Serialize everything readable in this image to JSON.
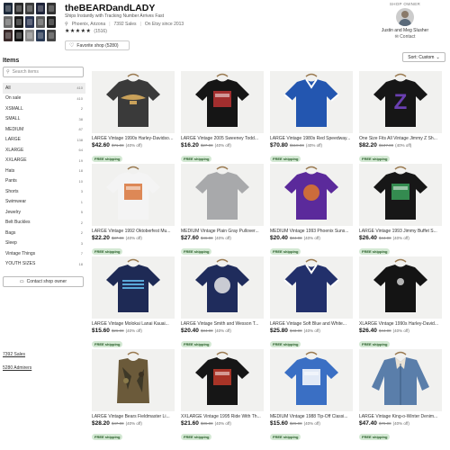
{
  "shop": {
    "name": "theBEARDandLADY",
    "tagline": "Ships Instantly with Tracking Number Arrives Fast",
    "location": "Phoenix, Arizona",
    "sales": "7392 Sales",
    "since": "On Etsy since 2013",
    "stars": "★★★★★",
    "review_count": "(1516)",
    "favorite_label": "Favorite shop (5280)",
    "heart_icon": "heart-icon",
    "mosaic_colors": [
      "#1e2a3a",
      "#2a2a2a",
      "#3d3d3d",
      "#20253a",
      "#333",
      "#6b6b6b",
      "#1a1a1a",
      "#2b3550",
      "#5a5a5a",
      "#202020",
      "#3a2a2a",
      "#151515",
      "#8a8a8a",
      "#2a3a55",
      "#444"
    ]
  },
  "owner": {
    "label": "SHOP OWNER",
    "name": "Justin and Meg Slusher",
    "contact": "Contact"
  },
  "sort": {
    "label": "Sort: Custom",
    "icon": "chevron-down-icon"
  },
  "sidebar": {
    "title": "Items",
    "search_placeholder": "Search items",
    "categories": [
      {
        "label": "All",
        "count": "410"
      },
      {
        "label": "On sale",
        "count": "410"
      },
      {
        "label": "XSMALL",
        "count": "2"
      },
      {
        "label": "SMALL",
        "count": "38"
      },
      {
        "label": "MEDIUM",
        "count": "87"
      },
      {
        "label": "LARGE",
        "count": "138"
      },
      {
        "label": "XLARGE",
        "count": "64"
      },
      {
        "label": "XXLARGE",
        "count": "19"
      },
      {
        "label": "Hats",
        "count": "18"
      },
      {
        "label": "Pants",
        "count": "10"
      },
      {
        "label": "Shorts",
        "count": "3"
      },
      {
        "label": "Swimwear",
        "count": "1"
      },
      {
        "label": "Jewelry",
        "count": "5"
      },
      {
        "label": "Belt Buckles",
        "count": "2"
      },
      {
        "label": "Bags",
        "count": "2"
      },
      {
        "label": "Sleep",
        "count": "3"
      },
      {
        "label": "Vintage Things",
        "count": "7"
      },
      {
        "label": "YOUTH SIZES",
        "count": "18"
      }
    ],
    "contact_label": "Contact shop owner",
    "sales_link": "7392 Sales",
    "admirers_link": "5280 Admirers"
  },
  "listings": [
    {
      "title": "LARGE Vintage 1990s Harley-Davidson...",
      "price": "$42.60",
      "orig": "$71.00",
      "off": "(40% off)",
      "badge": "FREE shipping",
      "shirt": "#3a3a3a",
      "accent": "#c9a15a",
      "print": "wings"
    },
    {
      "title": "LARGE Vintage 2005 Sweeney Todd...",
      "price": "$16.20",
      "orig": "$27.00",
      "off": "(40% off)",
      "badge": "FREE shipping",
      "shirt": "#151515",
      "accent": "#b33",
      "print": "box"
    },
    {
      "title": "LARGE Vintage 1980s Red Speedway...",
      "price": "$70.80",
      "orig": "$118.00",
      "off": "(40% off)",
      "badge": "FREE shipping",
      "shirt": "#2356b0",
      "accent": "#fff",
      "print": "vneck"
    },
    {
      "title": "One Size Fits All Vintage Jimmy Z Sh...",
      "price": "$82.20",
      "orig": "$137.00",
      "off": "(40% off)",
      "badge": "FREE shipping",
      "shirt": "#161616",
      "accent": "#6a3fb0",
      "print": "letter"
    },
    {
      "title": "LARGE Vintage 1992 Oktoberfest Mu...",
      "price": "$22.20",
      "orig": "$37.00",
      "off": "(40% off)",
      "badge": "FREE shipping",
      "shirt": "#f4f4f4",
      "accent": "#d8743a",
      "print": "box"
    },
    {
      "title": "MEDIUM Vintage Plain Gray Pullover...",
      "price": "$27.60",
      "orig": "$46.00",
      "off": "(40% off)",
      "badge": "FREE shipping",
      "shirt": "#a8a9ab",
      "accent": "#999",
      "print": "none"
    },
    {
      "title": "MEDIUM Vintage 1993 Phoenix Suns...",
      "price": "$20.40",
      "orig": "$34.00",
      "off": "(40% off)",
      "badge": "FREE shipping",
      "shirt": "#5b2a9b",
      "accent": "#e0782a",
      "print": "circle"
    },
    {
      "title": "LARGE Vintage 1993 Jimmy Buffet S...",
      "price": "$26.40",
      "orig": "$44.00",
      "off": "(40% off)",
      "badge": "FREE shipping",
      "shirt": "#171717",
      "accent": "#3aa05a",
      "print": "box"
    },
    {
      "title": "LARGE Vintage Molokai Lanai Kauai...",
      "price": "$15.60",
      "orig": "$26.00",
      "off": "(40% off)",
      "badge": "FREE shipping",
      "shirt": "#1e2a55",
      "accent": "#5aa8d8",
      "print": "stripes"
    },
    {
      "title": "LARGE Vintage Smith and Wesson T...",
      "price": "$20.40",
      "orig": "$34.00",
      "off": "(40% off)",
      "badge": "FREE shipping",
      "shirt": "#1f2c5c",
      "accent": "#e8e8e8",
      "print": "circle"
    },
    {
      "title": "LARGE Vintage Soft Blue and White...",
      "price": "$25.80",
      "orig": "$43.00",
      "off": "(40% off)",
      "badge": "FREE shipping",
      "shirt": "#22306b",
      "accent": "#fff",
      "print": "vneck"
    },
    {
      "title": "XLARGE Vintage 1990s Harley-David...",
      "price": "$26.40",
      "orig": "$44.00",
      "off": "(40% off)",
      "badge": "FREE shipping",
      "shirt": "#141414",
      "accent": "#ddd",
      "print": "small"
    },
    {
      "title": "LARGE Vintage Bears Fieldmaster Li...",
      "price": "$28.20",
      "orig": "$47.00",
      "off": "(40% off)",
      "badge": "FREE shipping",
      "shirt": "#6b5a3a",
      "accent": "#2a2a20",
      "print": "vest"
    },
    {
      "title": "XXLARGE Vintage 1995 Ride With Th...",
      "price": "$21.60",
      "orig": "$36.00",
      "off": "(40% off)",
      "badge": "FREE shipping",
      "shirt": "#161616",
      "accent": "#c23a2a",
      "print": "box"
    },
    {
      "title": "MEDIUM Vintage 1988 Tip-Off Classi...",
      "price": "$15.60",
      "orig": "$26.00",
      "off": "(40% off)",
      "badge": "FREE shipping",
      "shirt": "#3a6fc4",
      "accent": "#fff",
      "print": "box"
    },
    {
      "title": "LARGE Vintage King-o-Winter Denim...",
      "price": "$47.40",
      "orig": "$79.00",
      "off": "(40% off)",
      "badge": "FREE shipping",
      "shirt": "#5a7eaa",
      "accent": "#e9e1d4",
      "print": "jacket"
    }
  ]
}
